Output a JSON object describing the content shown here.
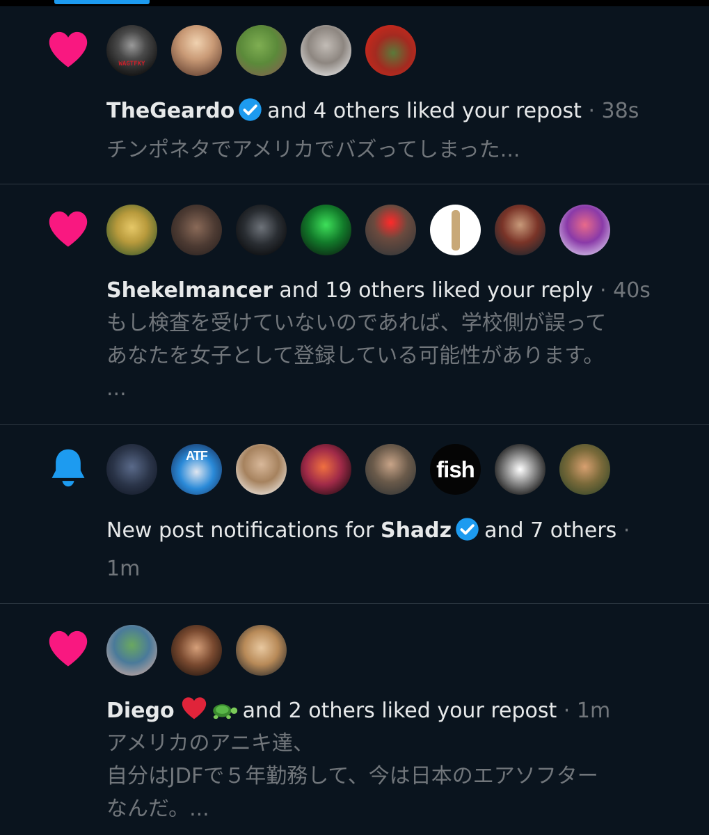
{
  "colors": {
    "background": "#0a141e",
    "divider": "#2f3a44",
    "like": "#f91880",
    "bell": "#1d9bf0",
    "verified": "#1d9bf0",
    "primary_text": "#e7e9ea",
    "secondary_text": "#71767b"
  },
  "notifications": [
    {
      "type": "like",
      "icon": "heart-icon",
      "user": "TheGeardo",
      "verified": true,
      "text": "and 4 others liked your repost",
      "separator": "·",
      "time": "38s",
      "preview": [
        "チンポネタでアメリカでバズってしまった..."
      ],
      "avatars": [
        {
          "name": "avatar-1",
          "label": "WAGTFKY"
        },
        {
          "name": "avatar-2"
        },
        {
          "name": "avatar-3"
        },
        {
          "name": "avatar-4"
        },
        {
          "name": "avatar-5"
        }
      ]
    },
    {
      "type": "like",
      "icon": "heart-icon",
      "user": "Shekelmancer",
      "verified": false,
      "text": "and 19 others liked your reply",
      "separator": "·",
      "time": "40s",
      "preview": [
        "もし検査を受けていないのであれば、学校側が誤って",
        "あなたを女子として登録している可能性があります。",
        "..."
      ],
      "avatars": [
        {
          "name": "avatar-1"
        },
        {
          "name": "avatar-2"
        },
        {
          "name": "avatar-3"
        },
        {
          "name": "avatar-4"
        },
        {
          "name": "avatar-5"
        },
        {
          "name": "avatar-6"
        },
        {
          "name": "avatar-7"
        },
        {
          "name": "avatar-8"
        }
      ]
    },
    {
      "type": "new-post",
      "icon": "bell-icon",
      "prefix": "New post notifications for",
      "user": "Shadz",
      "verified": true,
      "suffix": "and 7 others",
      "separator": "·",
      "time": "1m",
      "avatars": [
        {
          "name": "avatar-1"
        },
        {
          "name": "avatar-2",
          "label": "ATF"
        },
        {
          "name": "avatar-3"
        },
        {
          "name": "avatar-4"
        },
        {
          "name": "avatar-5"
        },
        {
          "name": "avatar-6",
          "label": "fish"
        },
        {
          "name": "avatar-7"
        },
        {
          "name": "avatar-8"
        }
      ]
    },
    {
      "type": "like",
      "icon": "heart-icon",
      "user": "Diego",
      "verified": false,
      "emojis": [
        "red-heart-emoji",
        "turtle-emoji"
      ],
      "text": "and 2 others liked your repost",
      "separator": "·",
      "time": "1m",
      "preview": [
        "アメリカのアニキ達、",
        "自分はJDFで５年勤務して、今は日本のエアソフター",
        "なんだ。..."
      ],
      "avatars": [
        {
          "name": "avatar-1"
        },
        {
          "name": "avatar-2"
        },
        {
          "name": "avatar-3"
        }
      ]
    }
  ]
}
